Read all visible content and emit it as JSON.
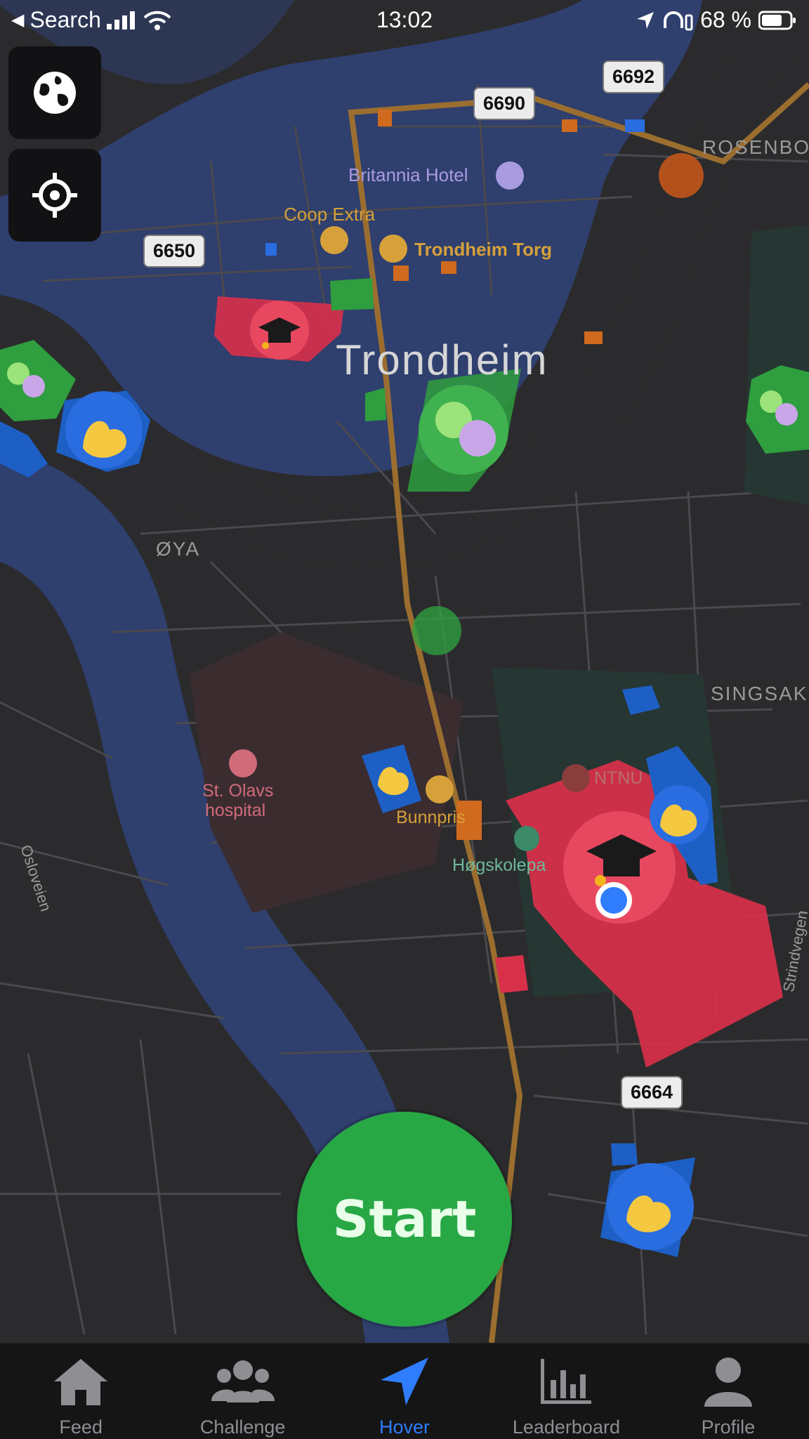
{
  "status_bar": {
    "back_label": "Search",
    "time": "13:02",
    "battery": "68 %"
  },
  "map": {
    "city": "Trondheim",
    "places": {
      "hotel": "Britannia Hotel",
      "coop": "Coop Extra",
      "torg": "Trondheim Torg",
      "oya": "ØYA",
      "hospital_line1": "St. Olavs",
      "hospital_line2": "hospital",
      "bunnpris": "Bunnpris",
      "hogskole": "Høgskolepa",
      "ntnu": "NTNU",
      "singsak": "SINGSAK",
      "rosenborg": "ROSENBO",
      "osloveien": "Osloveien",
      "strindvegen": "Strindvegen"
    },
    "roads": {
      "r6690": "6690",
      "r6692": "6692",
      "r6650": "6650",
      "r6664": "6664"
    }
  },
  "controls": {
    "globe_icon": "globe-icon",
    "locate_icon": "crosshair-icon"
  },
  "start_button": "Start",
  "tabbar": {
    "items": [
      {
        "label": "Feed",
        "icon": "home-icon"
      },
      {
        "label": "Challenge",
        "icon": "group-icon"
      },
      {
        "label": "Hover",
        "icon": "navigation-arrow-icon"
      },
      {
        "label": "Leaderboard",
        "icon": "bar-chart-icon"
      },
      {
        "label": "Profile",
        "icon": "person-icon"
      }
    ],
    "active": "Hover"
  },
  "colors": {
    "river": "#2f3f6e",
    "land": "#2b2b2d",
    "road_main": "#9b6e2f",
    "zone_red": "#d9304a",
    "zone_green": "#2e9e3e",
    "zone_blue": "#1d5fc4",
    "accent": "#2f7dfc"
  }
}
